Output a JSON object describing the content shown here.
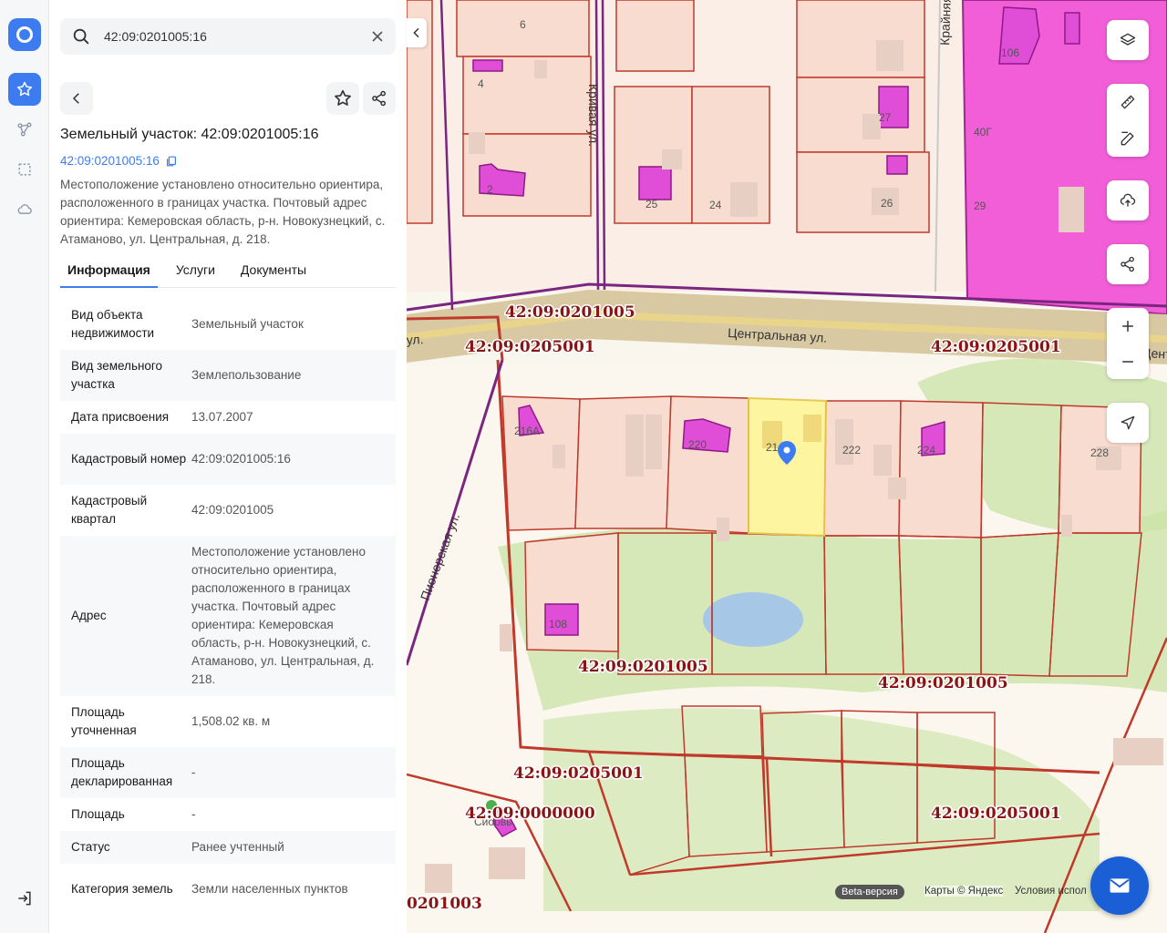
{
  "search": {
    "value": "42:09:0201005:16"
  },
  "parcel": {
    "title": "Земельный участок: 42:09:0201005:16",
    "cad_link": "42:09:0201005:16",
    "description": "Местоположение установлено относительно ориентира, расположенного в границах участка. Почтовый адрес ориентира: Кемеровская область, р-н. Новокузнецкий, с. Атаманово, ул. Центральная, д. 218."
  },
  "tabs": [
    {
      "label": "Информация",
      "active": true
    },
    {
      "label": "Услуги",
      "active": false
    },
    {
      "label": "Документы",
      "active": false
    }
  ],
  "rows": [
    {
      "key": "Вид объекта недвижимости",
      "value": "Земельный участок"
    },
    {
      "key": "Вид земельного участка",
      "value": "Землепользование"
    },
    {
      "key": "Дата присвоения",
      "value": "13.07.2007"
    },
    {
      "key": "Кадастровый номер",
      "value": "42:09:0201005:16"
    },
    {
      "key": "Кадастровый квартал",
      "value": "42:09:0201005"
    },
    {
      "key": "Адрес",
      "value": "Местоположение установлено относительно ориентира, расположенного в границах участка. Почтовый адрес ориентира: Кемеровская область, р-н. Новокузнецкий, с. Атаманово, ул. Центральная, д. 218."
    },
    {
      "key": "Площадь уточненная",
      "value": "1,508.02 кв. м"
    },
    {
      "key": "Площадь декларированная",
      "value": "-"
    },
    {
      "key": "Площадь",
      "value": "-"
    },
    {
      "key": "Статус",
      "value": "Ранее учтенный"
    },
    {
      "key": "Категория земель",
      "value": "Земли населенных пунктов"
    }
  ],
  "map": {
    "quarter_labels": [
      "42:09:0201005",
      "42:09:0205001",
      "42:09:0205001",
      "42:09:0201005",
      "42:09:0201005",
      "42:09:0205001",
      "42:09:0000000",
      "42:09:0205001",
      "0201003"
    ],
    "street": "Центральная ул.",
    "street_partial_left": "ул.",
    "street_partial_right": "Центр",
    "street_vertical_1": "Крайняя",
    "street_vertical_2": "Пионерская ул.",
    "street_vertical_3": "Кривая ул.",
    "house_numbers": [
      "6",
      "4",
      "2",
      "25",
      "24",
      "27",
      "26",
      "40Г",
      "29",
      "106",
      "216А",
      "220",
      "21",
      "222",
      "224",
      "228",
      "108"
    ],
    "poi": "Сиорвь",
    "beta": "Beta-версия",
    "copyright": "Карты © Яндекс",
    "terms": "Условия испол"
  },
  "colors": {
    "accent": "#3d7cf0",
    "parcel_highlight": "#fff59d",
    "building": "#e04ed8",
    "boundary": "#c0392b",
    "quarter_label": "#8a1414"
  },
  "icons": [
    "search-icon",
    "close-icon",
    "chevron-left-icon",
    "star-icon",
    "share-icon",
    "copy-icon",
    "layers-icon",
    "ruler-icon",
    "edit-icon",
    "upload-icon",
    "plus-icon",
    "minus-icon",
    "navigate-icon",
    "mail-icon"
  ]
}
